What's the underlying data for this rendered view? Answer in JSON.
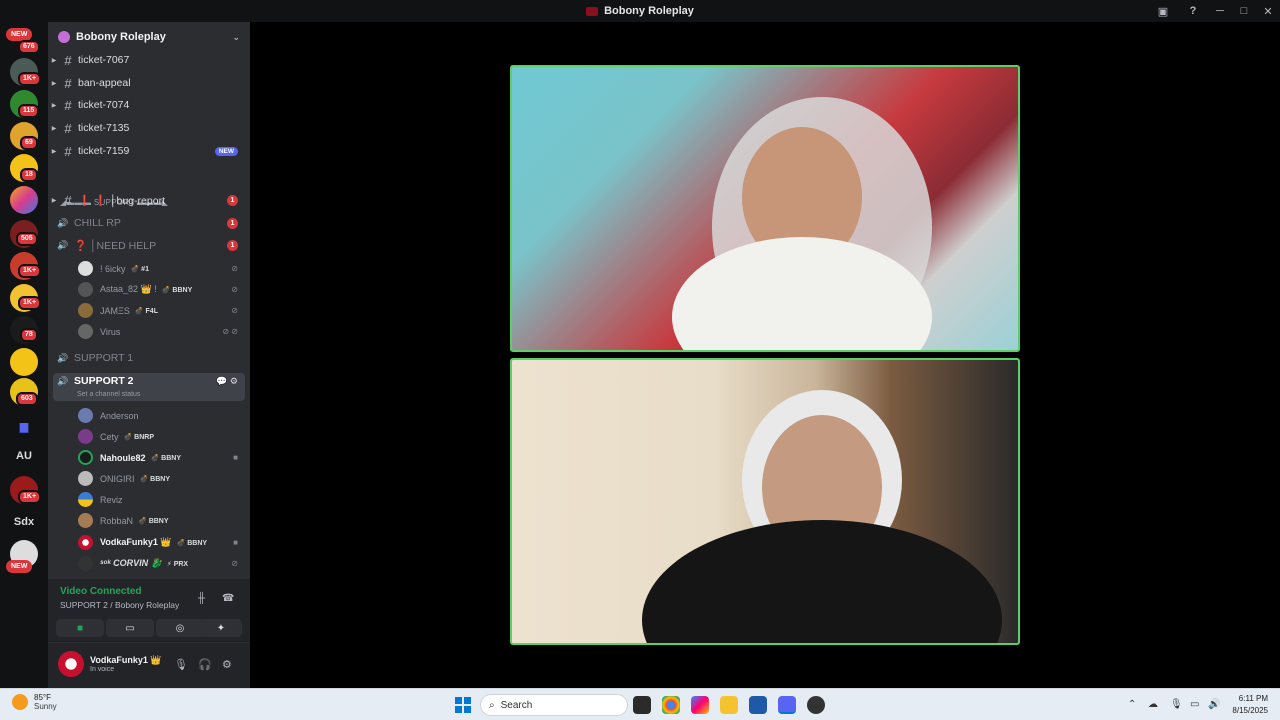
{
  "window": {
    "title": "Bobony Roleplay"
  },
  "servers": {
    "new_top": "NEW",
    "badges": [
      "676",
      "1K+",
      "115",
      "69",
      "18",
      "505",
      "1K+",
      "1K+",
      "78",
      "603",
      "1K+"
    ],
    "text_items": [
      "AU",
      "Sdx"
    ],
    "new_bottom": "NEW"
  },
  "guild": {
    "name": "Bobony Roleplay"
  },
  "channels": {
    "text": [
      {
        "label": "ticket-7067"
      },
      {
        "label": "ban-appeal"
      },
      {
        "label": "ticket-7074"
      },
      {
        "label": "ticket-7135"
      },
      {
        "label": "ticket-7159",
        "tag": "NEW"
      }
    ],
    "category": "◢▬▬▬ SUPPORT ▬▬▬◣",
    "bug_report": {
      "label": "❗ ❗ │bug-report",
      "mentions": "1"
    },
    "chill_rp": {
      "label": "CHILL RP",
      "mentions": "1"
    },
    "need_help": {
      "label": "❓ │NEED HELP",
      "mentions": "1"
    },
    "need_help_users": [
      {
        "name": "! 6icky",
        "tag": "💣 #1"
      },
      {
        "name": "Astaa_82 👑 !",
        "tag": "💣 BBNY"
      },
      {
        "name": "JAMΞS",
        "tag": "💣 F4L"
      },
      {
        "name": "Virus",
        "tag": ""
      }
    ],
    "support1": {
      "label": "SUPPORT 1"
    },
    "support2": {
      "label": "SUPPORT 2",
      "status": "Set a channel status"
    },
    "support2_users": [
      {
        "name": "Anderson",
        "tag": ""
      },
      {
        "name": "Cety",
        "tag": "💣 BNRP"
      },
      {
        "name": "Nahoule82",
        "tag": "💣 BBNY"
      },
      {
        "name": "ONIGIRI",
        "tag": "💣 BBNY"
      },
      {
        "name": "Reviz",
        "tag": ""
      },
      {
        "name": "RobbaN",
        "tag": "💣 BBNY"
      },
      {
        "name": "VodkaFunky1 👑",
        "tag": "💣 BBNY"
      },
      {
        "name": "ˢᵒᵏ CORVIN 🐉",
        "tag": "⚡ PRX"
      }
    ]
  },
  "voice": {
    "status": "Video Connected",
    "channel": "SUPPORT 2 / Bobony Roleplay"
  },
  "me": {
    "name": "VodkaFunky1 👑",
    "status": "In voice"
  },
  "taskbar": {
    "temp": "85°F",
    "weather": "Sunny",
    "search_placeholder": "Search",
    "time": "6:11 PM",
    "date": "8/15/2025"
  },
  "colors": {
    "speaking_border": "#5bd067",
    "accent": "#5865f2",
    "mention": "#da373c",
    "connected": "#23a559"
  }
}
